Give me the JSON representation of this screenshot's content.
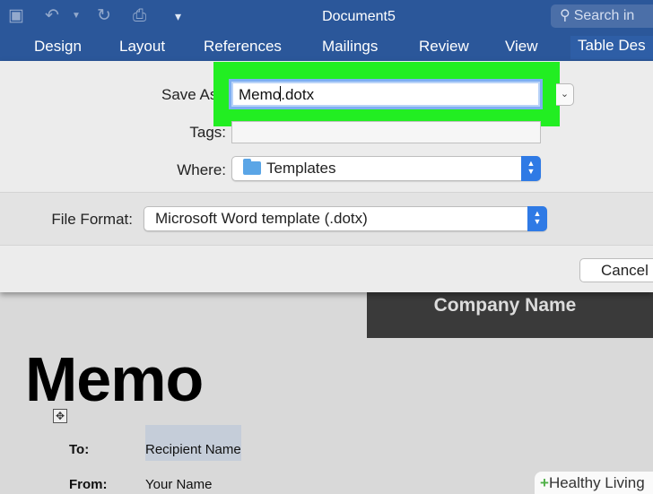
{
  "window": {
    "title": "Document5"
  },
  "quick_access": {
    "icons": [
      "save-icon",
      "undo-icon",
      "undo-dropdown-icon",
      "redo-icon",
      "print-icon",
      "customize-toolbar-icon"
    ]
  },
  "search": {
    "placeholder": "Search in"
  },
  "ribbon": {
    "tabs": [
      "Design",
      "Layout",
      "References",
      "Mailings",
      "Review",
      "View",
      "Table Des"
    ],
    "active_tab": "Table Des"
  },
  "save_dialog": {
    "save_as_label": "Save As:",
    "save_as_value": "Memo.dotx",
    "save_as_value_before_caret": "Memo",
    "save_as_value_after_caret": ".dotx",
    "tags_label": "Tags:",
    "tags_value": "",
    "where_label": "Where:",
    "where_value": "Templates",
    "file_format_label": "File Format:",
    "file_format_value": "Microsoft Word template (.dotx)",
    "cancel_label": "Cancel"
  },
  "document": {
    "company_name": "Company Name",
    "title": "Memo",
    "fields": [
      {
        "label": "To:",
        "value": "Recipient Name"
      },
      {
        "label": "From:",
        "value": "Your Name"
      }
    ]
  },
  "watermark": {
    "symbol": "+",
    "text": "Healthy Living"
  },
  "colors": {
    "ribbon": "#2b579a",
    "highlight": "#22ee22",
    "popup_accent": "#2f7ae5",
    "company_box": "#3a3a3a"
  }
}
